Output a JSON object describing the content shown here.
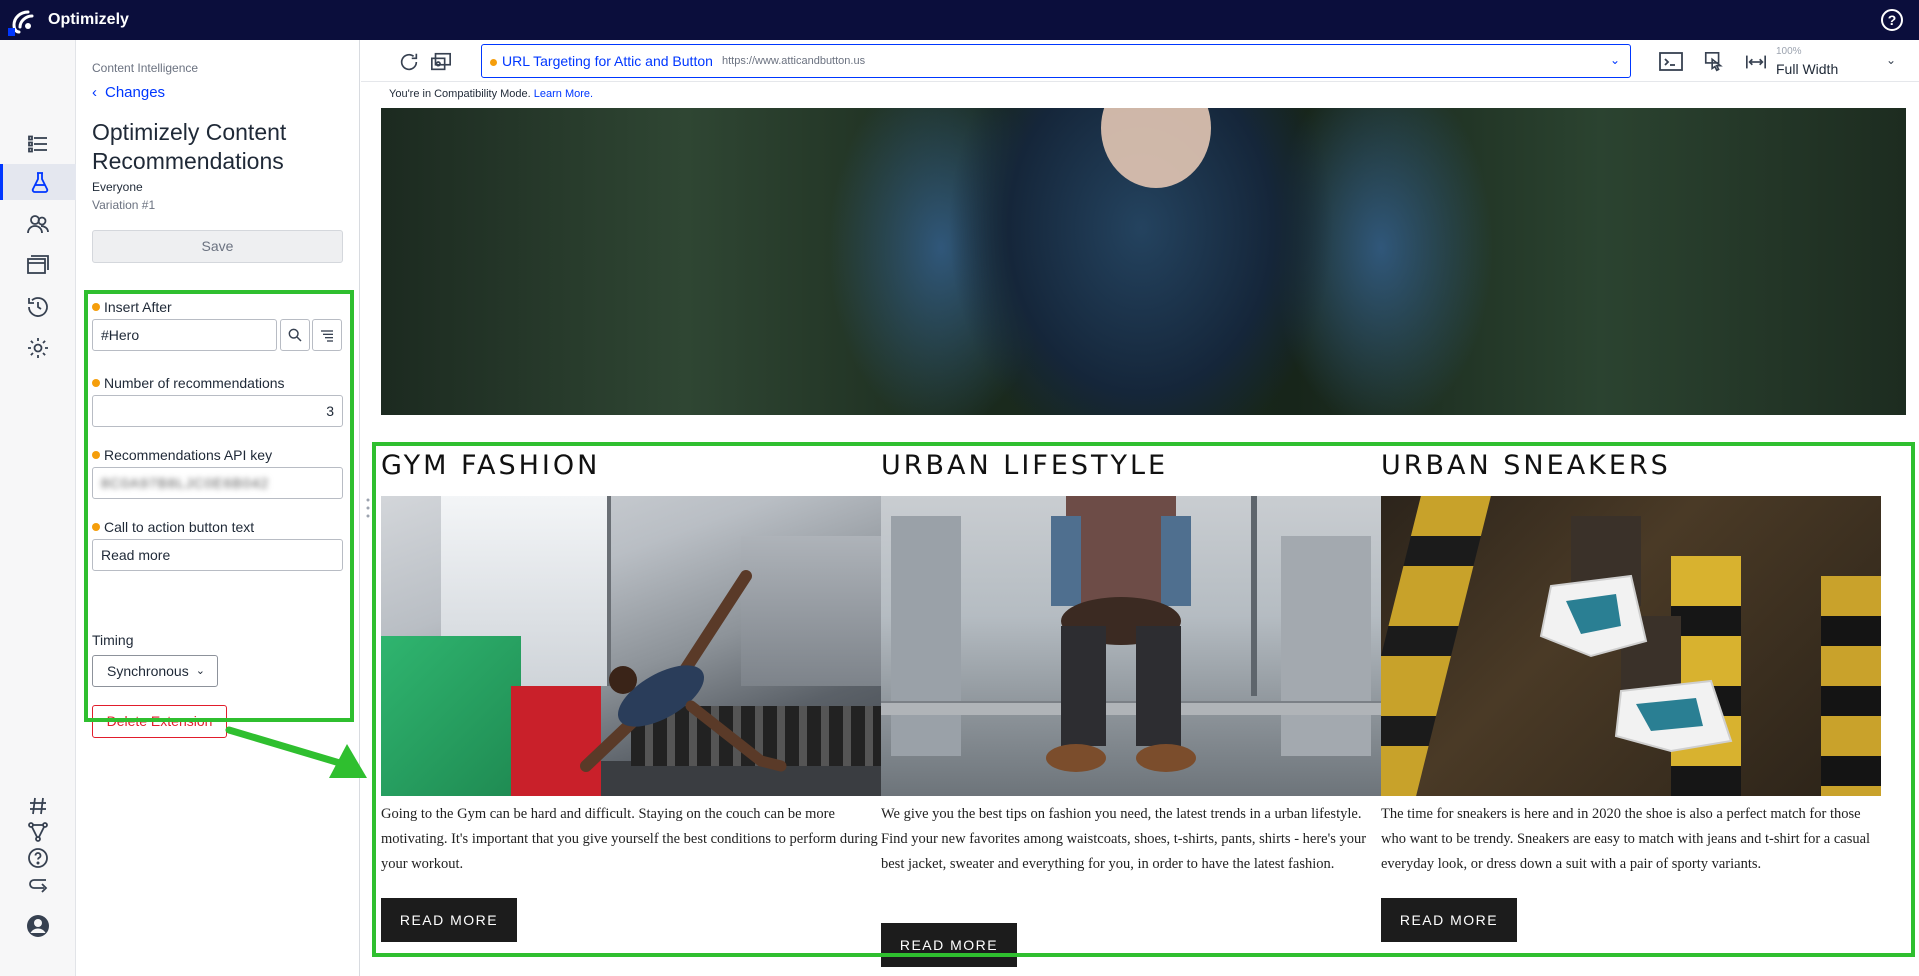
{
  "app": {
    "brand": "Optimizely",
    "help_label": "?"
  },
  "left_nav": {
    "icons": [
      "list-icon",
      "flask-icon",
      "audiences-icon",
      "pages-icon",
      "history-icon",
      "settings-icon",
      "hash-icon",
      "network-icon",
      "help-icon",
      "return-icon",
      "user-avatar-icon"
    ],
    "active": "flask-icon"
  },
  "side_panel": {
    "breadcrumb": "Content Intelligence",
    "back_label": "Changes",
    "title": "Optimizely Content Recommendations",
    "audience": "Everyone",
    "variation": "Variation #1",
    "save_label": "Save",
    "fields": {
      "insert_after": {
        "label": "Insert After",
        "value": "#Hero"
      },
      "num_recs": {
        "label": "Number of recommendations",
        "value": "3"
      },
      "api_key": {
        "label": "Recommendations API key",
        "value": "8C0A97B8LJC0E6B042"
      },
      "cta_text": {
        "label": "Call to action button text",
        "value": "Read more"
      }
    },
    "timing_label": "Timing",
    "timing_value": "Synchronous",
    "delete_label": "Delete Extension"
  },
  "toolbar": {
    "page_name": "URL Targeting for Attic and Button",
    "page_url": "https://www.atticandbutton.us",
    "zoom": "100%",
    "width_mode": "Full Width"
  },
  "compat": {
    "text": "You're in Compatibility Mode.",
    "link": "Learn More."
  },
  "cards": [
    {
      "title": "GYM FASHION",
      "text": "Going to the Gym can be hard and difficult. Staying on the couch can be more motivating. It's important that you give yourself the best conditions to perform during your workout.",
      "button": "READ MORE"
    },
    {
      "title": "URBAN LIFESTYLE",
      "text": "We give you the best tips on fashion you need, the latest trends in a urban lifestyle. Find your new favorites among waistcoats, shoes, t-shirts, pants, shirts - here's your best jacket, sweater and everything for you, in order to have the latest fashion.",
      "button": "READ MORE"
    },
    {
      "title": "URBAN SNEAKERS",
      "text": "The time for sneakers is here and in 2020 the shoe is also a perfect match for those who want to be trendy. Sneakers are easy to match with jeans and t-shirt for a casual everyday look, or dress down a suit with a pair of sporty variants.",
      "button": "READ MORE"
    }
  ],
  "colors": {
    "topbar": "#0b0e3c",
    "accent": "#0037ff",
    "highlight": "#2fbf2f",
    "danger": "#e11d2c",
    "required_dot": "#f59e0b"
  }
}
